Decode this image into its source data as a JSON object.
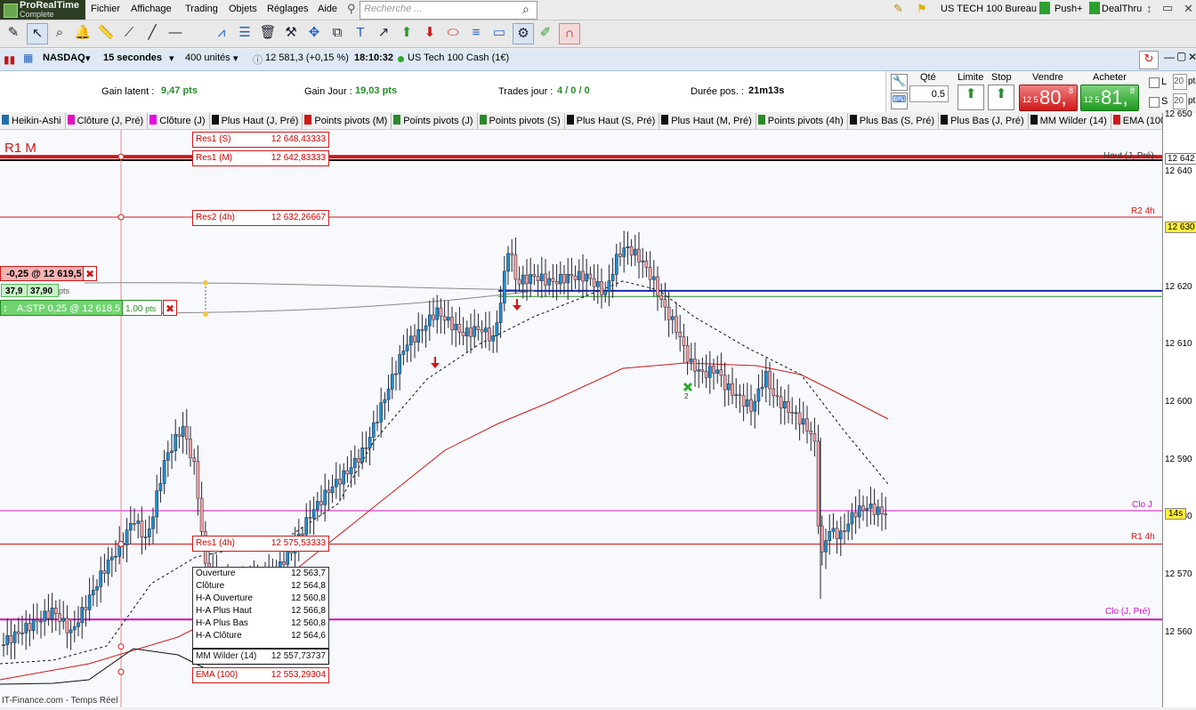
{
  "app": {
    "logo_line1": "ProRealTime",
    "logo_line2": "Complete"
  },
  "menu": [
    "Fichier",
    "Affichage",
    "Trading",
    "Objets",
    "Réglages",
    "Aide"
  ],
  "search": {
    "placeholder": "Recherche ..."
  },
  "topright": {
    "workspace": "US TECH 100 Bureau",
    "push": "Push+",
    "dealthru": "DealThru"
  },
  "chartbar": {
    "instrument": "NASDAQ",
    "timeframe": "15 secondes",
    "units": "400 unités",
    "price": "12 581,3 (+0,15 %)",
    "time": "18:10:32",
    "name": "US Tech 100 Cash (1€)"
  },
  "stats": {
    "gain_latent_label": "Gain latent :",
    "gain_latent": "9,47 pts",
    "gain_jour_label": "Gain Jour :",
    "gain_jour": "19,03 pts",
    "trades_label": "Trades jour :",
    "trades": "4 / 0 / 0",
    "duree_label": "Durée pos. :",
    "duree": "21m13s"
  },
  "trade": {
    "qty_label": "Qté",
    "qty": "0.5",
    "limite": "Limite",
    "stop": "Stop",
    "sell_label": "Vendre",
    "sell_small": "12 5",
    "sell_big": "80,",
    "sell_sup": "8",
    "buy_label": "Acheter",
    "buy_small": "12 5",
    "buy_big": "81,",
    "buy_sup": "8",
    "l": "L",
    "s": "S",
    "n20a": "20",
    "n20b": "20",
    "pts": "pts"
  },
  "indicators": [
    {
      "label": "Heikin-Ashi",
      "color": "#1f6fae"
    },
    {
      "label": "Clôture (J, Pré)",
      "color": "#e010c0"
    },
    {
      "label": "Clôture (J)",
      "color": "#e010e0"
    },
    {
      "label": "Plus Haut (J, Pré)",
      "color": "#101010"
    },
    {
      "label": "Points pivots (M)",
      "color": "#d01818"
    },
    {
      "label": "Points pivots (J)",
      "color": "#2a8a2a"
    },
    {
      "label": "Points pivots (S)",
      "color": "#2a8a2a"
    },
    {
      "label": "Plus Haut (S, Pré)",
      "color": "#101010"
    },
    {
      "label": "Plus Haut (M, Pré)",
      "color": "#101010"
    },
    {
      "label": "Points pivots (4h)",
      "color": "#2a8a2a"
    },
    {
      "label": "Plus Bas (S, Pré)",
      "color": "#101010"
    },
    {
      "label": "Plus Bas (J, Pré)",
      "color": "#101010"
    },
    {
      "label": "MM Wilder (14)",
      "color": "#101010"
    },
    {
      "label": "EMA (100)",
      "color": "#d01818"
    }
  ],
  "chart": {
    "r1m": "R1 M",
    "right_labels": {
      "haut_j_pre": "Haut (J, Pré)",
      "r2_4h": "R2 4h",
      "clo_j": "Clo J",
      "r1_4h": "R1 4h",
      "clo_j_pre": "Clo (J, Pré)"
    },
    "level_labels": [
      {
        "name": "Res1 (S)",
        "value": "12 648,43333"
      },
      {
        "name": "Res1 (M)",
        "value": "12 642,83333"
      },
      {
        "name": "Res2 (4h)",
        "value": "12 632,26667"
      },
      {
        "name": "Res1 (4h)",
        "value": "12 575,53333"
      },
      {
        "name": "MM Wilder (14)",
        "value": "12 557,73737"
      },
      {
        "name": "EMA (100)",
        "value": "12 553,29304"
      }
    ],
    "ohlc": [
      {
        "name": "Ouverture",
        "value": "12 563,7"
      },
      {
        "name": "Clôture",
        "value": "12 564,8"
      },
      {
        "name": "H-A Ouverture",
        "value": "12 560,8"
      },
      {
        "name": "H-A Plus Haut",
        "value": "12 566,8"
      },
      {
        "name": "H-A Plus Bas",
        "value": "12 560,8"
      },
      {
        "name": "H-A Clôture",
        "value": "12 564,6"
      }
    ],
    "order1": {
      "text": "-0,25 @ 12 619,5",
      "a": "37,9",
      "b": "37,90",
      "pts": "pts"
    },
    "order2": {
      "text": "A:STP 0,25 @ 12 618,5",
      "pts_val": "1,00",
      "pts": "pts"
    },
    "marker_number": "2",
    "countdown": "14s",
    "footer": "IT-Finance.com - Temps Réel",
    "axis": [
      {
        "text": "12 650",
        "price": 12650
      },
      {
        "text": "12 642",
        "price": 12642.4,
        "boxed": true
      },
      {
        "text": "12 640",
        "price": 12640
      },
      {
        "text": "12 630",
        "price": 12630.5,
        "yellow": true
      },
      {
        "text": "12 620",
        "price": 12620
      },
      {
        "text": "12 610",
        "price": 12610
      },
      {
        "text": "12 600",
        "price": 12600
      },
      {
        "text": "12 590",
        "price": 12590
      },
      {
        "text": "12 580",
        "price": 12580
      },
      {
        "text": "12 570",
        "price": 12570
      },
      {
        "text": "12 560",
        "price": 12560
      }
    ]
  }
}
